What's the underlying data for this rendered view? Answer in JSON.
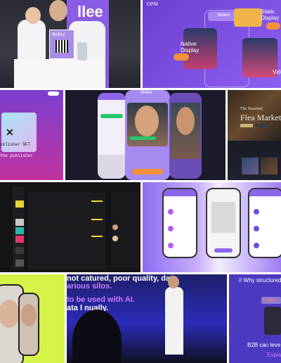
{
  "colors": {
    "purple": "#7a4fd8",
    "violet": "#5a2a8c",
    "orange": "#f3913a",
    "yellow_green": "#d6f34a",
    "magenta": "#c92ad0",
    "dark": "#1b1b22"
  },
  "tiles": {
    "booth": {
      "sign": "llee",
      "board": "Bollzz"
    },
    "cpm": {
      "header": "CPM",
      "phone_label": "Bollee",
      "static_display": "Static Display",
      "native_display": "Native Display",
      "video": "Video"
    },
    "sticker": {
      "line1": "ublisher NFT",
      "line2": "the publisher"
    },
    "chat": {
      "app_name": "Bollee"
    },
    "flea": {
      "subtitle": "The Smartest",
      "title": "Flea Market"
    },
    "editor": {},
    "phones3": {},
    "faces": {},
    "stage": {
      "line1": "not catured, poor quality, data",
      "line2": "arious silos.",
      "line3": "to be used with AI.",
      "line4": "ata l           nually."
    },
    "why": {
      "title": "// Why structured",
      "false_label": "False",
      "b2b": "B2B can leve",
      "expl": "Expla"
    }
  }
}
